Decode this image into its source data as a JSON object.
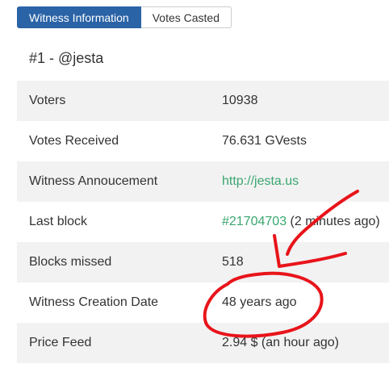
{
  "tabs": [
    {
      "label": "Witness Information",
      "active": true
    },
    {
      "label": "Votes Casted",
      "active": false
    }
  ],
  "witness_title": "#1 - @jesta",
  "rows": [
    {
      "label": "Voters",
      "value": "10938"
    },
    {
      "label": "Votes Received",
      "value": "76.631 GVests"
    },
    {
      "label": "Witness Annoucement",
      "link": "http://jesta.us"
    },
    {
      "label": "Last block",
      "link": "#21704703",
      "suffix": " (2 minutes ago)"
    },
    {
      "label": "Blocks missed",
      "value": "518"
    },
    {
      "label": "Witness Creation Date",
      "value": "48 years ago"
    },
    {
      "label": "Price Feed",
      "value": "2.94 $ (an hour ago)"
    }
  ],
  "colors": {
    "tab_active": "#2a63a6",
    "link": "#3aa66f",
    "annotation": "#e8141a",
    "stripe": "#f2f2f2"
  }
}
